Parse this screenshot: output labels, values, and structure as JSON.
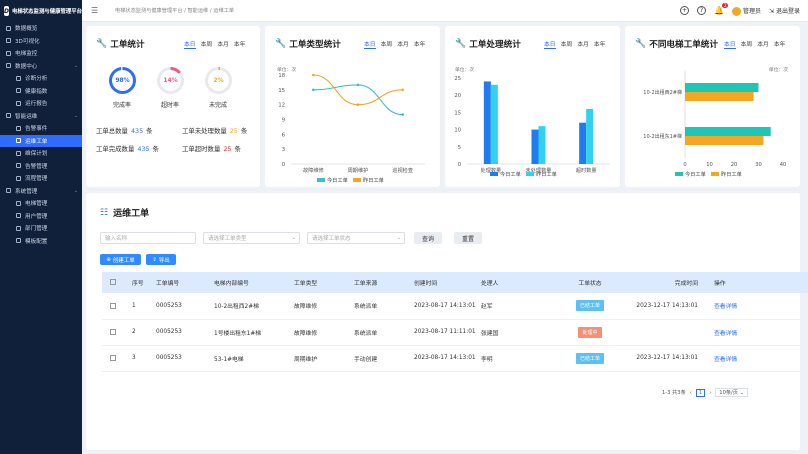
{
  "app": {
    "title": "电梯状态监测与健康管理平台",
    "logo_mark": "D"
  },
  "sidebar": {
    "items": [
      {
        "label": "数据概览",
        "level": 0
      },
      {
        "label": "3D可视化",
        "level": 0
      },
      {
        "label": "电梯监控",
        "level": 0
      },
      {
        "label": "数据中心",
        "level": 0,
        "expanded": true
      },
      {
        "label": "诊断分析",
        "level": 1
      },
      {
        "label": "健康指数",
        "level": 1
      },
      {
        "label": "运行报告",
        "level": 1
      },
      {
        "label": "智能运维",
        "level": 0,
        "expanded": true
      },
      {
        "label": "告警事件",
        "level": 1
      },
      {
        "label": "运维工单",
        "level": 1,
        "active": true
      },
      {
        "label": "维保计划",
        "level": 1
      },
      {
        "label": "告警管理",
        "level": 1
      },
      {
        "label": "流程管理",
        "level": 1
      },
      {
        "label": "系统管理",
        "level": 0,
        "expanded": true
      },
      {
        "label": "电梯管理",
        "level": 1
      },
      {
        "label": "用户管理",
        "level": 1
      },
      {
        "label": "部门管理",
        "level": 1
      },
      {
        "label": "模板配置",
        "level": 1
      }
    ]
  },
  "topbar": {
    "breadcrumb": "电梯状态监测与健康管理平台 / 智能运维 / 运维工单",
    "notification_count": "2",
    "user_name": "管理员",
    "logout_label": "退出登录"
  },
  "periods": [
    "本日",
    "本周",
    "本月",
    "本年"
  ],
  "stats_card": {
    "title": "工单统计",
    "rings": [
      {
        "value": "98%",
        "label": "完成率",
        "color": "#2f6bff"
      },
      {
        "value": "14%",
        "label": "超时率",
        "color": "#f5577a"
      },
      {
        "value": "2%",
        "label": "未完成",
        "color": "#f5a623"
      }
    ],
    "rows": [
      {
        "label": "工单总数量",
        "value": "435",
        "unit": "条"
      },
      {
        "label": "工单未处理数量",
        "value": "25",
        "unit": "条"
      },
      {
        "label": "工单完成数量",
        "value": "435",
        "unit": "条"
      },
      {
        "label": "工单超时数量",
        "value": "25",
        "unit": "条"
      }
    ]
  },
  "type_card": {
    "title": "工单类型统计"
  },
  "process_card": {
    "title": "工单处理统计"
  },
  "elevator_card": {
    "title": "不同电梯工单统计"
  },
  "chart_data": [
    {
      "type": "line",
      "unit_label": "单位：次",
      "categories": [
        "故障维修",
        "周期维护",
        "巡视检查"
      ],
      "ylim": [
        0,
        18
      ],
      "yticks": [
        0,
        3,
        6,
        9,
        12,
        15,
        18
      ],
      "series": [
        {
          "name": "今日工单",
          "color": "#3ac0c9",
          "values": [
            15,
            16,
            10
          ]
        },
        {
          "name": "昨日工单",
          "color": "#f5a623",
          "values": [
            18,
            12,
            15
          ]
        }
      ]
    },
    {
      "type": "bar",
      "unit_label": "单位：次",
      "categories": [
        "处理数量",
        "未处理数量",
        "超时数量"
      ],
      "ylim": [
        0,
        25
      ],
      "yticks": [
        0,
        5,
        10,
        15,
        20,
        25
      ],
      "series": [
        {
          "name": "今日工单",
          "color": "#1e7bf0",
          "values": [
            24,
            10,
            12
          ]
        },
        {
          "name": "昨日工单",
          "color": "#33d1f0",
          "values": [
            23,
            11,
            16
          ]
        }
      ]
    },
    {
      "type": "bar-horizontal",
      "unit_label": "单位：次",
      "categories": [
        "10-2出租西2#梯",
        "10-2出租东1#梯"
      ],
      "xlim": [
        0,
        40
      ],
      "xticks": [
        0,
        10,
        20,
        30,
        40
      ],
      "series": [
        {
          "name": "今日工单",
          "color": "#1fc6b6",
          "values": [
            30,
            35
          ]
        },
        {
          "name": "昨日工单",
          "color": "#f5a623",
          "values": [
            28,
            32
          ]
        }
      ]
    }
  ],
  "workorders": {
    "title": "运维工单",
    "filters": {
      "name_placeholder": "输入名称",
      "type_placeholder": "请选择工单类型",
      "status_placeholder": "请选择工单状态",
      "query_label": "查询",
      "reset_label": "重置"
    },
    "actions": {
      "create_label": "创建工单",
      "export_label": "导出"
    },
    "columns": [
      "序号",
      "工单编号",
      "电梯内部编号",
      "工单类型",
      "工单来源",
      "创建时间",
      "处理人",
      "工单状态",
      "完成时间",
      "操作"
    ],
    "rows": [
      {
        "idx": "1",
        "id": "0005253",
        "elevator": "10-2出租西2#梯",
        "type": "故障维修",
        "source": "系统派单",
        "created": "2023-08-17 14:13:01",
        "handler": "赵军",
        "status": "已结工单",
        "status_color": "#5cc0f5",
        "finished": "2023-12-17 14:13:01",
        "op": "查看详情"
      },
      {
        "idx": "2",
        "id": "0005253",
        "elevator": "1号楼出租东1#梯",
        "type": "故障维修",
        "source": "系统派单",
        "created": "2023-08-17 11:11:01",
        "handler": "张建国",
        "status": "处理中",
        "status_color": "#f78f76",
        "finished": "",
        "op": "查看详情"
      },
      {
        "idx": "3",
        "id": "0005253",
        "elevator": "53-1#电梯",
        "type": "周期维护",
        "source": "手动创建",
        "created": "2023-08-17 14:13:01",
        "handler": "李明",
        "status": "已结工单",
        "status_color": "#5cc0f5",
        "finished": "2023-12-17 14:13:01",
        "op": "查看详情"
      }
    ],
    "pager": {
      "total": "1-3 共3条",
      "page": "1",
      "size": "10条/页"
    }
  }
}
